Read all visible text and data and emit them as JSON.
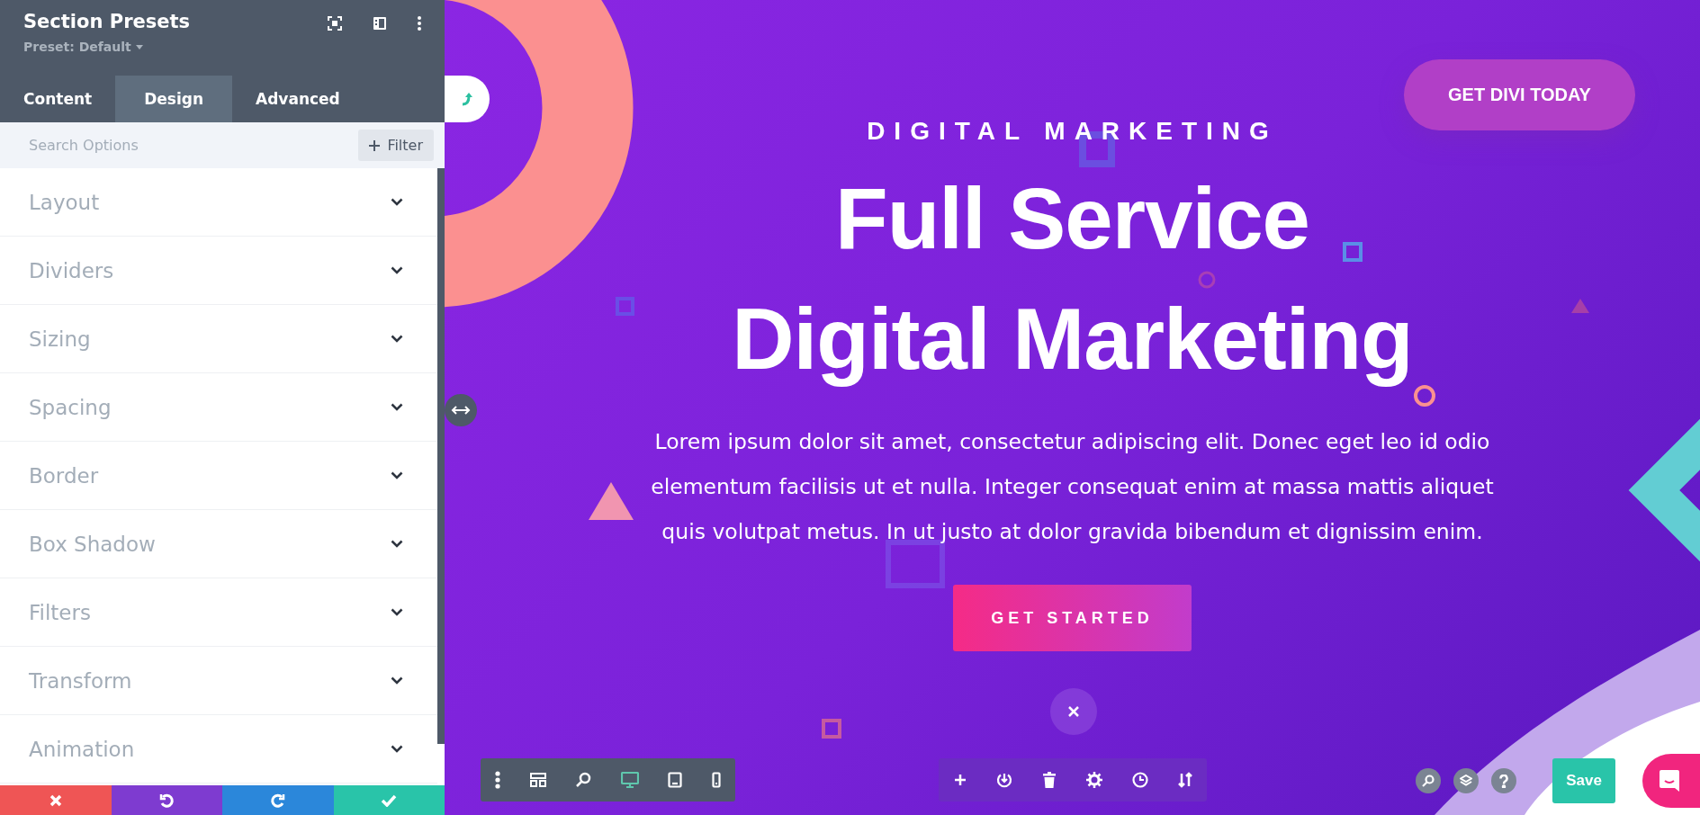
{
  "panel": {
    "title": "Section Presets",
    "preset": "Preset: Default",
    "tabs": [
      {
        "label": "Content",
        "selected": false
      },
      {
        "label": "Design",
        "selected": true
      },
      {
        "label": "Advanced",
        "selected": false
      }
    ],
    "search": {
      "placeholder": "Search Options"
    },
    "filter_button": "Filter",
    "groups": [
      {
        "label": "Layout",
        "expanded": false
      },
      {
        "label": "Dividers",
        "expanded": false
      },
      {
        "label": "Sizing",
        "expanded": false
      },
      {
        "label": "Spacing",
        "expanded": false
      },
      {
        "label": "Border",
        "expanded": false
      },
      {
        "label": "Box Shadow",
        "expanded": false
      },
      {
        "label": "Filters",
        "expanded": false
      },
      {
        "label": "Transform",
        "expanded": false
      },
      {
        "label": "Animation",
        "expanded": false
      }
    ],
    "actions": [
      {
        "kind": "cancel"
      },
      {
        "kind": "undo"
      },
      {
        "kind": "redo"
      },
      {
        "kind": "confirm"
      }
    ]
  },
  "hero": {
    "eyebrow": "DIGITAL MARKETING",
    "title_lines": [
      "Full Service",
      "Digital Marketing"
    ],
    "body": "Lorem ipsum dolor sit amet, consectetur adipiscing elit. Donec eget leo id odio elementum facilisis ut et nulla. Integer consequat enim at massa mattis aliquet quis volutpat metus. In ut justo at dolor gravida bibendum et dignissim enim.",
    "cta": "GET STARTED",
    "top_button": "GET DIVI TODAY"
  },
  "view_modes": [
    {
      "kind": "desktop",
      "selected": true
    },
    {
      "kind": "tablet",
      "selected": false
    },
    {
      "kind": "phone",
      "selected": false
    }
  ],
  "save_button": "Save"
}
